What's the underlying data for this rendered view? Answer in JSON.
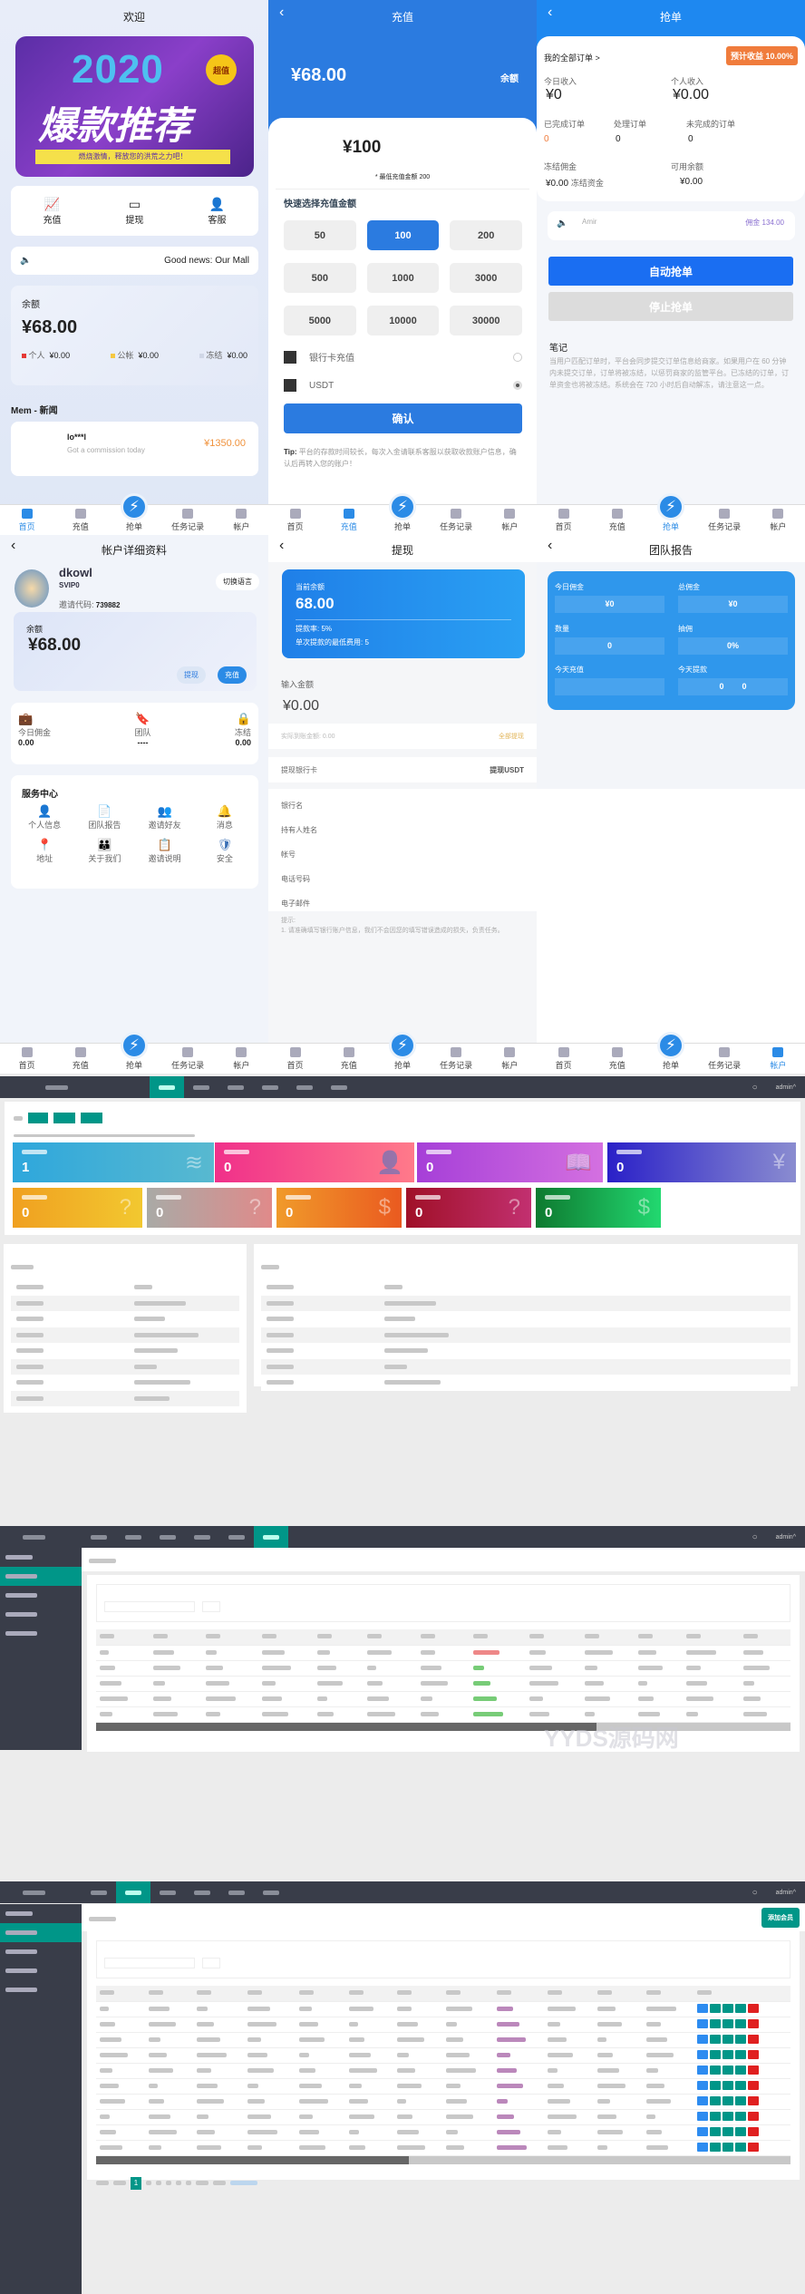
{
  "colors": {
    "primary": "#2b7be0",
    "accent_blue": "#2b8be6",
    "admin_dark": "#393d49",
    "admin_teal": "#009688",
    "orange": "#f07c3c"
  },
  "nav": {
    "items": [
      {
        "label": "首页",
        "icon": "home-icon"
      },
      {
        "label": "充值",
        "icon": "card-icon"
      },
      {
        "label": "抢单",
        "icon": "bolt-icon"
      },
      {
        "label": "任务记录",
        "icon": "document-icon"
      },
      {
        "label": "帐户",
        "icon": "user-icon"
      }
    ]
  },
  "home": {
    "title": "欢迎",
    "banner": {
      "year": "2020",
      "headline": "爆款推荐",
      "ribbon": "燃烧激情，释放您的洪荒之力吧！",
      "badge": "超值"
    },
    "quick": [
      {
        "label": "充值",
        "icon": "chart-icon"
      },
      {
        "label": "提现",
        "icon": "wallet-icon"
      },
      {
        "label": "客服",
        "icon": "support-icon"
      }
    ],
    "notice": "Good news: Our Mall",
    "balance_label": "余额",
    "balance": "¥68.00",
    "legend": [
      {
        "label": "个人",
        "value": "¥0.00",
        "color": "#e53935"
      },
      {
        "label": "公帐",
        "value": "¥0.00",
        "color": "#f5c842"
      },
      {
        "label": "冻结",
        "value": "¥0.00",
        "color": "#cfd6e6"
      }
    ],
    "news_title": "Mem - 新闻",
    "news": {
      "user": "lo***l",
      "text": "Got a commission today",
      "amount": "¥1350.00"
    }
  },
  "recharge": {
    "title": "充值",
    "balance": "¥68.00",
    "balance_label": "余额",
    "amount": "¥100",
    "min_note": "* 最低充值金额 200",
    "quick_title": "快速选择充值金额",
    "amounts": [
      "50",
      "100",
      "200",
      "500",
      "1000",
      "3000",
      "5000",
      "10000",
      "30000"
    ],
    "selected": "100",
    "methods": [
      {
        "label": "银行卡充值",
        "selected": false
      },
      {
        "label": "USDT",
        "selected": true
      }
    ],
    "confirm": "确认",
    "tip_label": "Tip:",
    "tip": "平台的存款时间较长，每次入金请联系客服以获取收款账户信息，确认后再转入您的账户！"
  },
  "grab": {
    "title": "抢单",
    "orders_link": "我的全部订单 >",
    "badge": "预计收益 10.00%",
    "today_label": "今日收入",
    "today": "¥0",
    "personal_label": "个人收入",
    "personal": "¥0.00",
    "counts": [
      {
        "label": "已完成订单",
        "value": "0"
      },
      {
        "label": "处理订单",
        "value": "0"
      },
      {
        "label": "未完成的订单",
        "value": "0"
      }
    ],
    "frozen_label": "冻结佣金",
    "frozen": "¥0.00",
    "frozen_unit": "冻结资金",
    "avail_label": "可用余额",
    "avail": "¥0.00",
    "ticker": {
      "user": "Amir",
      "amount": "佣金 134.00"
    },
    "auto": "自动抢单",
    "stop": "停止抢单",
    "note_title": "笔记",
    "note": "当用户匹配订单时，平台会同步提交订单信息给商家。如果用户在 60 分钟内未提交订单，订单将被冻结，以惩罚商家的监管平台。已冻结的订单，订单资金也将被冻结。系统会在 720 小时后自动解冻，请注意这一点。"
  },
  "account": {
    "title": "帐户详细资料",
    "name": "dkowl",
    "level": "SVIP0",
    "invite_label": "邀请代码:",
    "invite_code": "739882",
    "lang_button": "切换语言",
    "balance_label": "余额",
    "balance": "¥68.00",
    "withdraw": "提现",
    "recharge": "充值",
    "stats": [
      {
        "label": "今日佣金",
        "value": "0.00",
        "icon": "briefcase-icon"
      },
      {
        "label": "团队",
        "value": "----",
        "icon": "bookmark-icon"
      },
      {
        "label": "冻结",
        "value": "0.00",
        "icon": "lock-icon"
      }
    ],
    "service_title": "服务中心",
    "services": [
      {
        "label": "个人信息",
        "icon": "person-icon"
      },
      {
        "label": "团队报告",
        "icon": "file-icon"
      },
      {
        "label": "邀请好友",
        "icon": "add-user-icon"
      },
      {
        "label": "消息",
        "icon": "bell-icon"
      },
      {
        "label": "地址",
        "icon": "location-icon"
      },
      {
        "label": "关于我们",
        "icon": "team-icon"
      },
      {
        "label": "邀请说明",
        "icon": "list-icon"
      },
      {
        "label": "安全",
        "icon": "shield-icon"
      }
    ]
  },
  "withdraw": {
    "title": "提现",
    "balance_label": "当前余额",
    "balance": "68.00",
    "rate": "提款率: 5%",
    "min_fee": "单次提款的最低费用: 5",
    "input_label": "输入金额",
    "input_value": "¥0.00",
    "actual": "实际到账金额: 0.00",
    "all": "全部提现",
    "method_bank": "提现银行卡",
    "method_usdt": "提现USDT",
    "fields": [
      "银行名",
      "持有人姓名",
      "帐号",
      "电话号码",
      "电子邮件"
    ],
    "tip_title": "提示:",
    "tip": "1. 请准确填写银行账户信息，我们不会因您的填写错误造成的损失，负责任务。"
  },
  "team": {
    "title": "团队报告",
    "cells": [
      {
        "label": "今日佣金",
        "value": "¥0"
      },
      {
        "label": "总佣金",
        "value": "¥0"
      },
      {
        "label": "数量",
        "value": "0"
      },
      {
        "label": "抽佣",
        "value": "0%"
      },
      {
        "label": "今天充值",
        "value": ""
      },
      {
        "label": "今天提款",
        "value": "0        0"
      }
    ]
  },
  "admin": {
    "user": "admin",
    "dashboard_stats": [
      "1",
      "0",
      "0",
      "0",
      "0",
      "0",
      "0",
      "0",
      "0"
    ],
    "watermark": "YYDS源码网",
    "add_button": "添加会员",
    "current_page": "1"
  }
}
